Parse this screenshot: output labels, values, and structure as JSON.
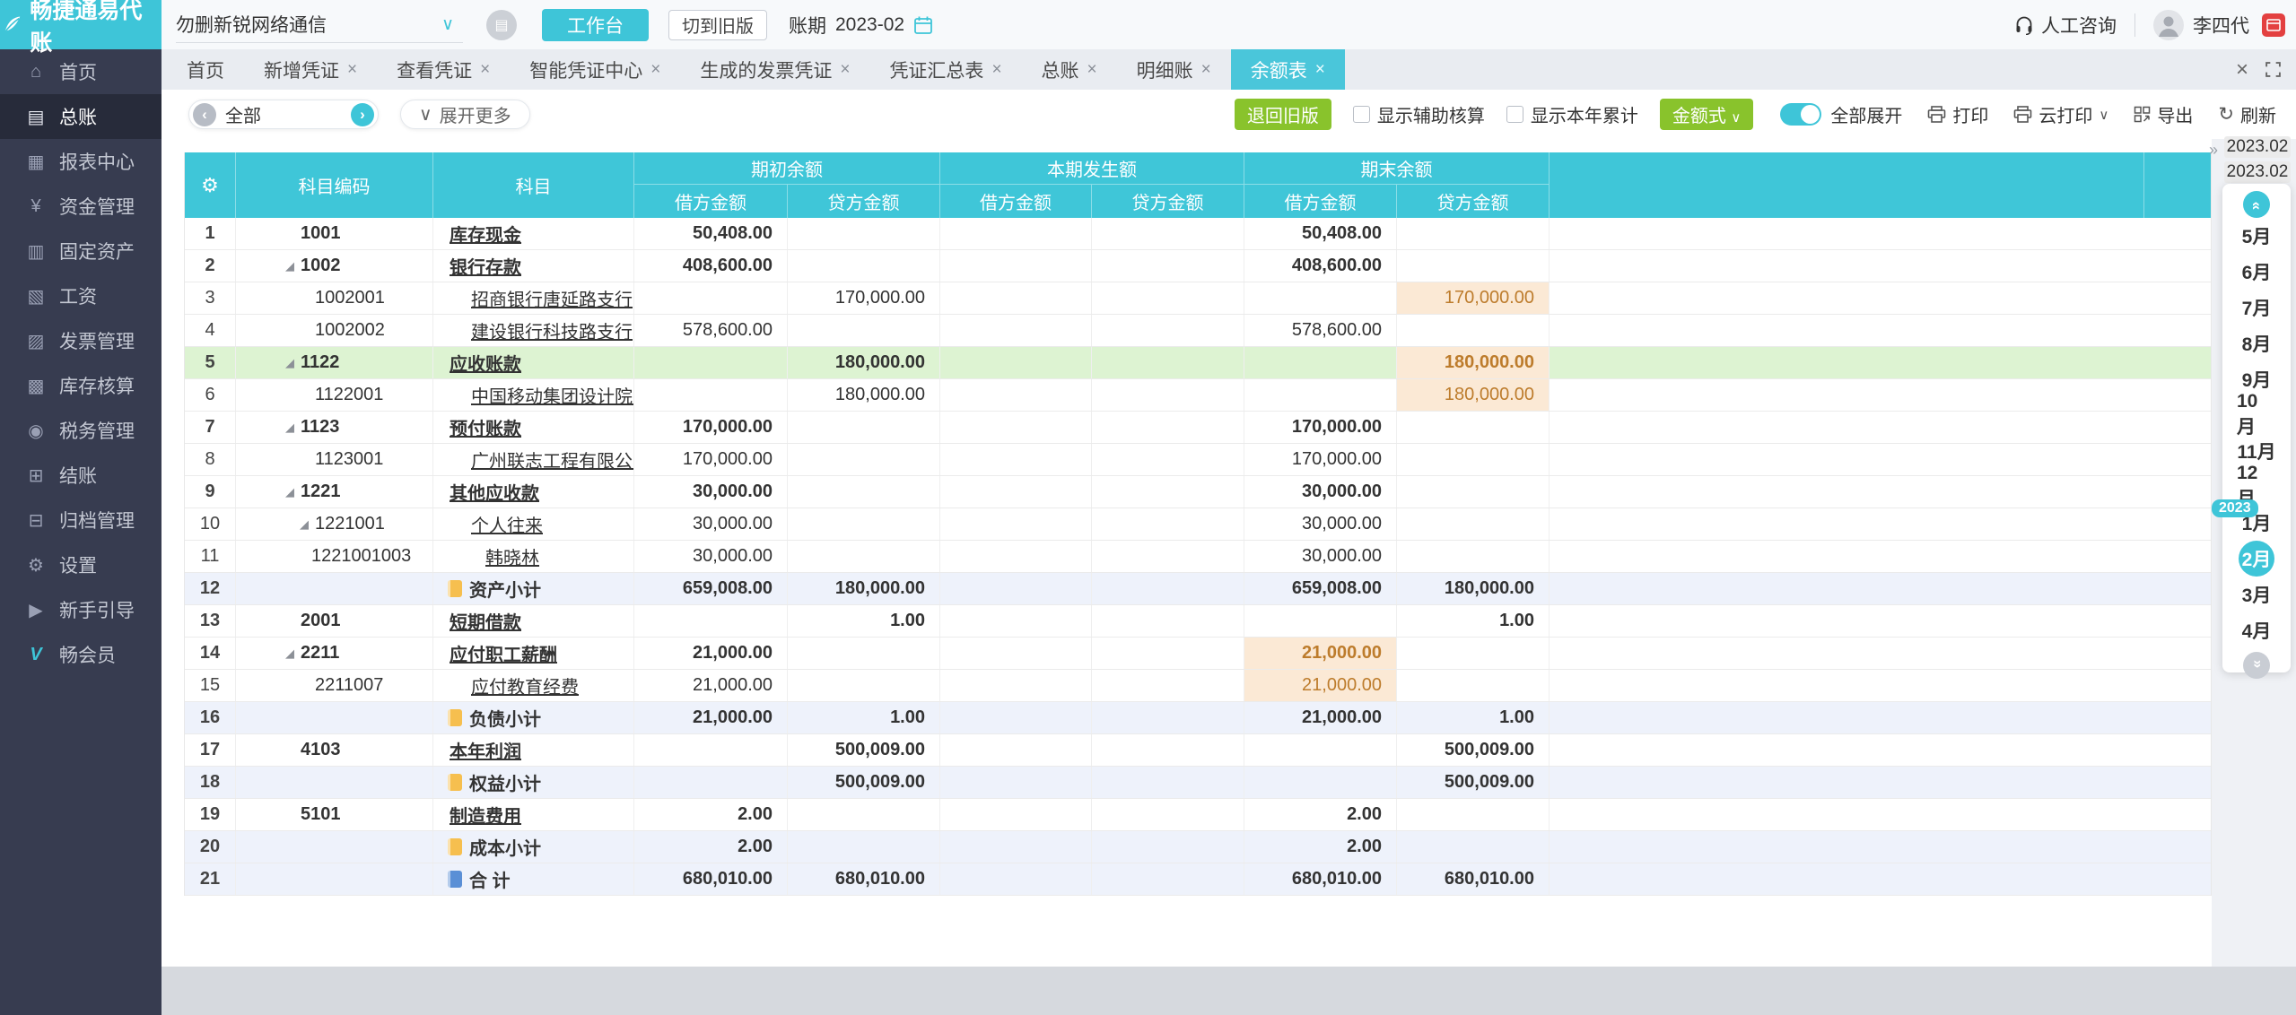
{
  "topbar": {
    "logo": "畅捷通易代账",
    "company": "勿删新锐网络通信",
    "workbench": "工作台",
    "switch_old": "切到旧版",
    "period_label": "账期",
    "period_value": "2023-02",
    "support": "人工咨询",
    "user": "李四代"
  },
  "sidebar": {
    "items": [
      {
        "label": "首页",
        "icon": "home-icon",
        "glyph": "⌂",
        "active": false
      },
      {
        "label": "总账",
        "icon": "ledger-icon",
        "glyph": "▤",
        "active": true
      },
      {
        "label": "报表中心",
        "icon": "report-center-icon",
        "glyph": "▦",
        "active": false
      },
      {
        "label": "资金管理",
        "icon": "funds-icon",
        "glyph": "¥",
        "active": false
      },
      {
        "label": "固定资产",
        "icon": "fixed-assets-icon",
        "glyph": "▥",
        "active": false
      },
      {
        "label": "工资",
        "icon": "salary-icon",
        "glyph": "▧",
        "active": false
      },
      {
        "label": "发票管理",
        "icon": "invoice-icon",
        "glyph": "▨",
        "active": false
      },
      {
        "label": "库存核算",
        "icon": "inventory-icon",
        "glyph": "▩",
        "active": false
      },
      {
        "label": "税务管理",
        "icon": "tax-icon",
        "glyph": "◉",
        "active": false
      },
      {
        "label": "结账",
        "icon": "closing-icon",
        "glyph": "⊞",
        "active": false
      },
      {
        "label": "归档管理",
        "icon": "archive-icon",
        "glyph": "⊟",
        "active": false
      },
      {
        "label": "设置",
        "icon": "settings-icon",
        "glyph": "⚙",
        "active": false
      },
      {
        "label": "新手引导",
        "icon": "guide-icon",
        "glyph": "▶",
        "active": false
      },
      {
        "label": "畅会员",
        "icon": "member-icon",
        "glyph": "V",
        "active": false,
        "vip": true
      }
    ]
  },
  "tabs": {
    "items": [
      {
        "label": "首页",
        "closable": false,
        "active": false
      },
      {
        "label": "新增凭证",
        "closable": true,
        "active": false
      },
      {
        "label": "查看凭证",
        "closable": true,
        "active": false
      },
      {
        "label": "智能凭证中心",
        "closable": true,
        "active": false
      },
      {
        "label": "生成的发票凭证",
        "closable": true,
        "active": false
      },
      {
        "label": "凭证汇总表",
        "closable": true,
        "active": false
      },
      {
        "label": "总账",
        "closable": true,
        "active": false
      },
      {
        "label": "明细账",
        "closable": true,
        "active": false
      },
      {
        "label": "余额表",
        "closable": true,
        "active": true
      }
    ],
    "close_icon": "×"
  },
  "toolbar": {
    "filter_value": "全部",
    "expand_more": "展开更多",
    "back_old": "退回旧版",
    "show_aux": "显示辅助核算",
    "show_ytd": "显示本年累计",
    "amount_style": "金额式",
    "expand_all": "全部展开",
    "print": "打印",
    "cloud_print": "云打印",
    "export": "导出",
    "refresh": "刷新"
  },
  "table": {
    "headers": {
      "code": "科目编码",
      "subject": "科目",
      "groups": [
        "期初余额",
        "本期发生额",
        "期末余额"
      ],
      "debit": "借方金额",
      "credit": "贷方金额"
    },
    "rows": [
      {
        "n": "1",
        "code": "1001",
        "tri": false,
        "lvl": 1,
        "name": "库存现金",
        "link": true,
        "bold": true,
        "qcj": "50,408.00",
        "qcd": "",
        "bqj": "",
        "bqd": "",
        "qmj": "50,408.00",
        "qmd": "",
        "hl": "",
        "bg": "",
        "icon": ""
      },
      {
        "n": "2",
        "code": "1002",
        "tri": true,
        "lvl": 1,
        "name": "银行存款",
        "link": true,
        "bold": true,
        "qcj": "408,600.00",
        "qcd": "",
        "bqj": "",
        "bqd": "",
        "qmj": "408,600.00",
        "qmd": "",
        "hl": "",
        "bg": "",
        "icon": ""
      },
      {
        "n": "3",
        "code": "1002001",
        "tri": false,
        "lvl": 2,
        "name": "招商银行唐延路支行",
        "link": true,
        "bold": false,
        "qcj": "",
        "qcd": "170,000.00",
        "bqj": "",
        "bqd": "",
        "qmj": "",
        "qmd": "170,000.00",
        "hl": "qmd",
        "bg": "",
        "icon": ""
      },
      {
        "n": "4",
        "code": "1002002",
        "tri": false,
        "lvl": 2,
        "name": "建设银行科技路支行",
        "link": true,
        "bold": false,
        "qcj": "578,600.00",
        "qcd": "",
        "bqj": "",
        "bqd": "",
        "qmj": "578,600.00",
        "qmd": "",
        "hl": "",
        "bg": "",
        "icon": ""
      },
      {
        "n": "5",
        "code": "1122",
        "tri": true,
        "lvl": 1,
        "name": "应收账款",
        "link": true,
        "bold": true,
        "qcj": "",
        "qcd": "180,000.00",
        "bqj": "",
        "bqd": "",
        "qmj": "",
        "qmd": "180,000.00",
        "hl": "qmd",
        "bg": "g",
        "icon": ""
      },
      {
        "n": "6",
        "code": "1122001",
        "tri": false,
        "lvl": 2,
        "name": "中国移动集团设计院有限公司陕",
        "link": true,
        "bold": false,
        "qcj": "",
        "qcd": "180,000.00",
        "bqj": "",
        "bqd": "",
        "qmj": "",
        "qmd": "180,000.00",
        "hl": "qmd",
        "bg": "",
        "icon": ""
      },
      {
        "n": "7",
        "code": "1123",
        "tri": true,
        "lvl": 1,
        "name": "预付账款",
        "link": true,
        "bold": true,
        "qcj": "170,000.00",
        "qcd": "",
        "bqj": "",
        "bqd": "",
        "qmj": "170,000.00",
        "qmd": "",
        "hl": "",
        "bg": "",
        "icon": ""
      },
      {
        "n": "8",
        "code": "1123001",
        "tri": false,
        "lvl": 2,
        "name": "广州联志工程有限公司",
        "link": true,
        "bold": false,
        "qcj": "170,000.00",
        "qcd": "",
        "bqj": "",
        "bqd": "",
        "qmj": "170,000.00",
        "qmd": "",
        "hl": "",
        "bg": "",
        "icon": ""
      },
      {
        "n": "9",
        "code": "1221",
        "tri": true,
        "lvl": 1,
        "name": "其他应收款",
        "link": true,
        "bold": true,
        "qcj": "30,000.00",
        "qcd": "",
        "bqj": "",
        "bqd": "",
        "qmj": "30,000.00",
        "qmd": "",
        "hl": "",
        "bg": "",
        "icon": ""
      },
      {
        "n": "10",
        "code": "1221001",
        "tri": true,
        "lvl": 2,
        "name": "个人往来",
        "link": true,
        "bold": false,
        "qcj": "30,000.00",
        "qcd": "",
        "bqj": "",
        "bqd": "",
        "qmj": "30,000.00",
        "qmd": "",
        "hl": "",
        "bg": "",
        "icon": ""
      },
      {
        "n": "11",
        "code": "1221001003",
        "tri": false,
        "lvl": 3,
        "name": "韩晓林",
        "link": true,
        "bold": false,
        "qcj": "30,000.00",
        "qcd": "",
        "bqj": "",
        "bqd": "",
        "qmj": "30,000.00",
        "qmd": "",
        "hl": "",
        "bg": "",
        "icon": ""
      },
      {
        "n": "12",
        "code": "",
        "tri": false,
        "lvl": 0,
        "name": "资产小计",
        "link": false,
        "bold": true,
        "qcj": "659,008.00",
        "qcd": "180,000.00",
        "bqj": "",
        "bqd": "",
        "qmj": "659,008.00",
        "qmd": "180,000.00",
        "hl": "",
        "bg": "b",
        "icon": "y"
      },
      {
        "n": "13",
        "code": "2001",
        "tri": false,
        "lvl": 1,
        "name": "短期借款",
        "link": true,
        "bold": true,
        "qcj": "",
        "qcd": "1.00",
        "bqj": "",
        "bqd": "",
        "qmj": "",
        "qmd": "1.00",
        "hl": "",
        "bg": "",
        "icon": ""
      },
      {
        "n": "14",
        "code": "2211",
        "tri": true,
        "lvl": 1,
        "name": "应付职工薪酬",
        "link": true,
        "bold": true,
        "qcj": "21,000.00",
        "qcd": "",
        "bqj": "",
        "bqd": "",
        "qmj": "21,000.00",
        "qmd": "",
        "hl": "qmj",
        "bg": "",
        "icon": ""
      },
      {
        "n": "15",
        "code": "2211007",
        "tri": false,
        "lvl": 2,
        "name": "应付教育经费",
        "link": true,
        "bold": false,
        "qcj": "21,000.00",
        "qcd": "",
        "bqj": "",
        "bqd": "",
        "qmj": "21,000.00",
        "qmd": "",
        "hl": "qmj",
        "bg": "",
        "icon": ""
      },
      {
        "n": "16",
        "code": "",
        "tri": false,
        "lvl": 0,
        "name": "负债小计",
        "link": false,
        "bold": true,
        "qcj": "21,000.00",
        "qcd": "1.00",
        "bqj": "",
        "bqd": "",
        "qmj": "21,000.00",
        "qmd": "1.00",
        "hl": "",
        "bg": "b",
        "icon": "y"
      },
      {
        "n": "17",
        "code": "4103",
        "tri": false,
        "lvl": 1,
        "name": "本年利润",
        "link": true,
        "bold": true,
        "qcj": "",
        "qcd": "500,009.00",
        "bqj": "",
        "bqd": "",
        "qmj": "",
        "qmd": "500,009.00",
        "hl": "",
        "bg": "",
        "icon": ""
      },
      {
        "n": "18",
        "code": "",
        "tri": false,
        "lvl": 0,
        "name": "权益小计",
        "link": false,
        "bold": true,
        "qcj": "",
        "qcd": "500,009.00",
        "bqj": "",
        "bqd": "",
        "qmj": "",
        "qmd": "500,009.00",
        "hl": "",
        "bg": "b",
        "icon": "y"
      },
      {
        "n": "19",
        "code": "5101",
        "tri": false,
        "lvl": 1,
        "name": "制造费用",
        "link": true,
        "bold": true,
        "qcj": "2.00",
        "qcd": "",
        "bqj": "",
        "bqd": "",
        "qmj": "2.00",
        "qmd": "",
        "hl": "",
        "bg": "",
        "icon": ""
      },
      {
        "n": "20",
        "code": "",
        "tri": false,
        "lvl": 0,
        "name": "成本小计",
        "link": false,
        "bold": true,
        "qcj": "2.00",
        "qcd": "",
        "bqj": "",
        "bqd": "",
        "qmj": "2.00",
        "qmd": "",
        "hl": "",
        "bg": "b",
        "icon": "y"
      },
      {
        "n": "21",
        "code": "",
        "tri": false,
        "lvl": 0,
        "name": "合  计",
        "link": false,
        "bold": true,
        "qcj": "680,010.00",
        "qcd": "680,010.00",
        "bqj": "",
        "bqd": "",
        "qmj": "680,010.00",
        "qmd": "680,010.00",
        "hl": "",
        "bg": "b",
        "icon": "bl"
      }
    ]
  },
  "month_panel": {
    "period_top": "2023.02",
    "period_bottom": "2023.02",
    "year_badge": "2023",
    "months": [
      "5月",
      "6月",
      "7月",
      "8月",
      "9月",
      "10月",
      "11月",
      "12月",
      "1月",
      "2月",
      "3月",
      "4月"
    ],
    "selected": "2月"
  },
  "colors": {
    "teal": "#3ec5d8",
    "green": "#89c32c",
    "highlight_bg": "#fbe9d5",
    "row_selected": "#ddf3d2",
    "row_subtotal": "#eef2fb"
  }
}
